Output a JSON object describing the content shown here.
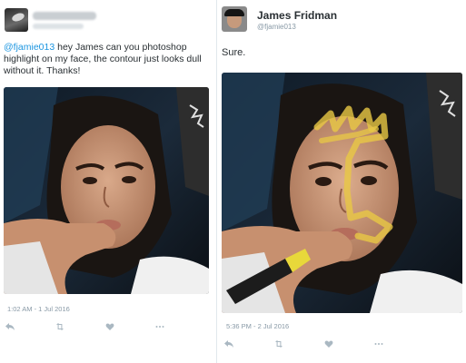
{
  "left_tweet": {
    "text_mention": "@fjamie013",
    "text_body": " hey James can you photoshop highlight on my face, the contour just looks dull without it. Thanks!",
    "timestamp": "1:02 AM - 1 Jul 2016"
  },
  "right_tweet": {
    "name": "James Fridman",
    "handle": "@fjamie013",
    "text": "Sure.",
    "timestamp": "5:36 PM - 2 Jul 2016"
  },
  "icons": {
    "reply": "reply-icon",
    "retweet": "retweet-icon",
    "like": "heart-icon",
    "more": "more-icon"
  },
  "colors": {
    "mention": "#1b95e0",
    "meta_text": "#8899a6",
    "highlight": "#e8c845"
  }
}
